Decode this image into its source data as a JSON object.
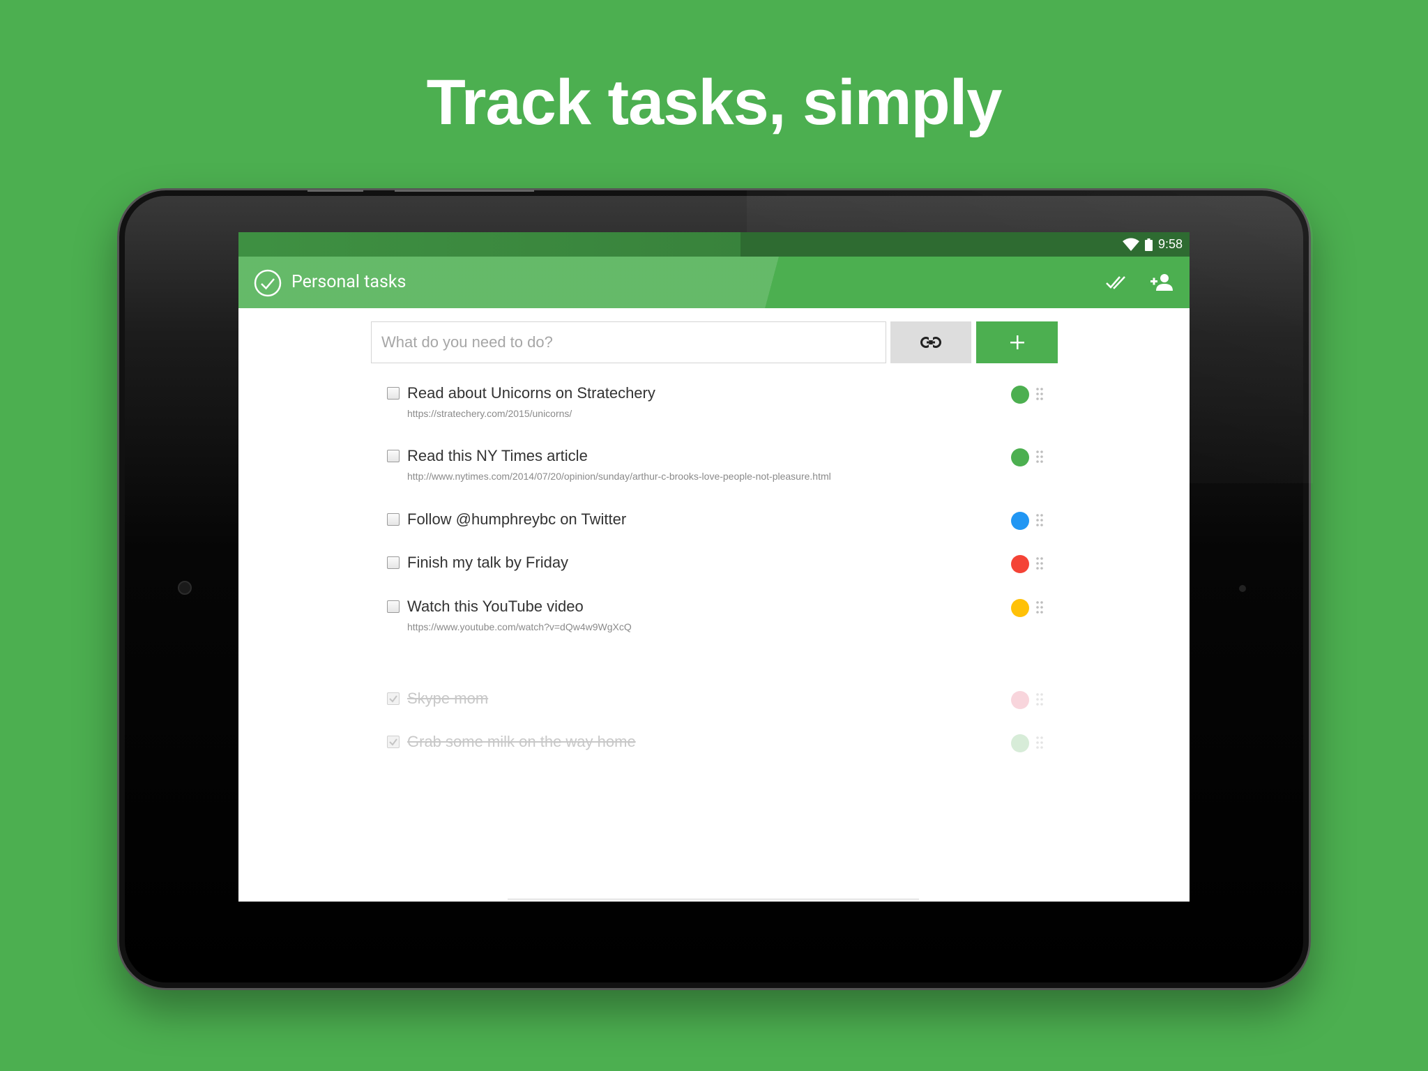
{
  "headline": "Track tasks, simply",
  "status_bar": {
    "time": "9:58"
  },
  "app_bar": {
    "title": "Personal tasks"
  },
  "input": {
    "placeholder": "What do you need to do?"
  },
  "colors": {
    "background": "#4caf50",
    "accent": "#4caf50",
    "status_bar": "#2e6b31",
    "dot_green": "#4caf50",
    "dot_blue": "#2196f3",
    "dot_red": "#f44336",
    "dot_yellow": "#ffc107",
    "dot_pink_faded": "#f8d5dc",
    "dot_green_faded": "#d7ecd8"
  },
  "tasks": [
    {
      "title": "Read about Unicorns on Stratechery",
      "url": "https://stratechery.com/2015/unicorns/",
      "color": "#4caf50",
      "done": false
    },
    {
      "title": "Read this NY Times article",
      "url": "http://www.nytimes.com/2014/07/20/opinion/sunday/arthur-c-brooks-love-people-not-pleasure.html",
      "color": "#4caf50",
      "done": false
    },
    {
      "title": "Follow @humphreybc on Twitter",
      "url": "",
      "color": "#2196f3",
      "done": false
    },
    {
      "title": "Finish my talk by Friday",
      "url": "",
      "color": "#f44336",
      "done": false
    },
    {
      "title": "Watch this YouTube video",
      "url": "https://www.youtube.com/watch?v=dQw4w9WgXcQ",
      "color": "#ffc107",
      "done": false
    }
  ],
  "completed_tasks": [
    {
      "title": "Skype mom",
      "color": "#f8d5dc",
      "done": true
    },
    {
      "title": "Grab some milk on the way home",
      "color": "#d7ecd8",
      "done": true
    }
  ],
  "icons": {
    "app_logo": "check-circle-icon",
    "mark_all": "double-check-icon",
    "share": "add-person-icon",
    "link": "link-icon",
    "add": "plus-icon",
    "nav_back": "back-triangle-icon",
    "nav_home": "home-circle-icon",
    "nav_recents": "recents-square-icon"
  }
}
